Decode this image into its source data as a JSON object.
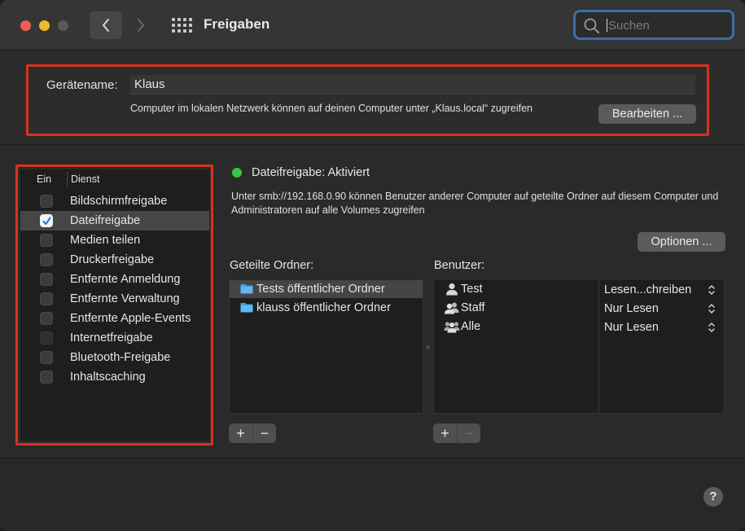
{
  "window": {
    "title": "Freigaben",
    "search": {
      "placeholder": "Suchen",
      "value": ""
    }
  },
  "device": {
    "label": "Gerätename:",
    "name": "Klaus",
    "info": "Computer im lokalen Netzwerk können auf deinen Computer unter „Klaus.local“ zugreifen",
    "edit_button": "Bearbeiten ..."
  },
  "services": {
    "header_on": "Ein",
    "header_service": "Dienst",
    "items": [
      {
        "label": "Bildschirmfreigabe",
        "checked": false
      },
      {
        "label": "Dateifreigabe",
        "checked": true
      },
      {
        "label": "Medien teilen",
        "checked": false
      },
      {
        "label": "Druckerfreigabe",
        "checked": false
      },
      {
        "label": "Entfernte Anmeldung",
        "checked": false
      },
      {
        "label": "Entfernte Verwaltung",
        "checked": false
      },
      {
        "label": "Entfernte Apple-Events",
        "checked": false
      },
      {
        "label": "Internetfreigabe",
        "checked": false
      },
      {
        "label": "Bluetooth-Freigabe",
        "checked": false
      },
      {
        "label": "Inhaltscaching",
        "checked": false
      }
    ],
    "selected": "Dateifreigabe"
  },
  "detail": {
    "status": "Dateifreigabe: Aktiviert",
    "status_color": "#33c748",
    "description": "Unter smb://192.168.0.90 können Benutzer anderer Computer auf geteilte Ordner auf diesem Computer und Administratoren auf alle Volumes zugreifen",
    "options_button": "Optionen ...",
    "shared_folders_title": "Geteilte Ordner:",
    "shared_folders": [
      {
        "label": "Tests öffentlicher Ordner",
        "icon": "folder-icon"
      },
      {
        "label": "klauss öffentlicher Ordner",
        "icon": "folder-icon"
      }
    ],
    "users_title": "Benutzer:",
    "users": [
      {
        "name": "Test",
        "icon": "user-icon",
        "permission": "Lesen...chreiben"
      },
      {
        "name": "Staff",
        "icon": "group-icon",
        "permission": "Nur Lesen"
      },
      {
        "name": "Alle",
        "icon": "everyone-icon",
        "permission": "Nur Lesen"
      }
    ],
    "add_label": "+",
    "remove_label": "−"
  },
  "help_label": "?",
  "colors": {
    "accent": "#3a6ea5",
    "annotation_red": "#d8321e",
    "folder_blue": "#3ea3e8"
  }
}
